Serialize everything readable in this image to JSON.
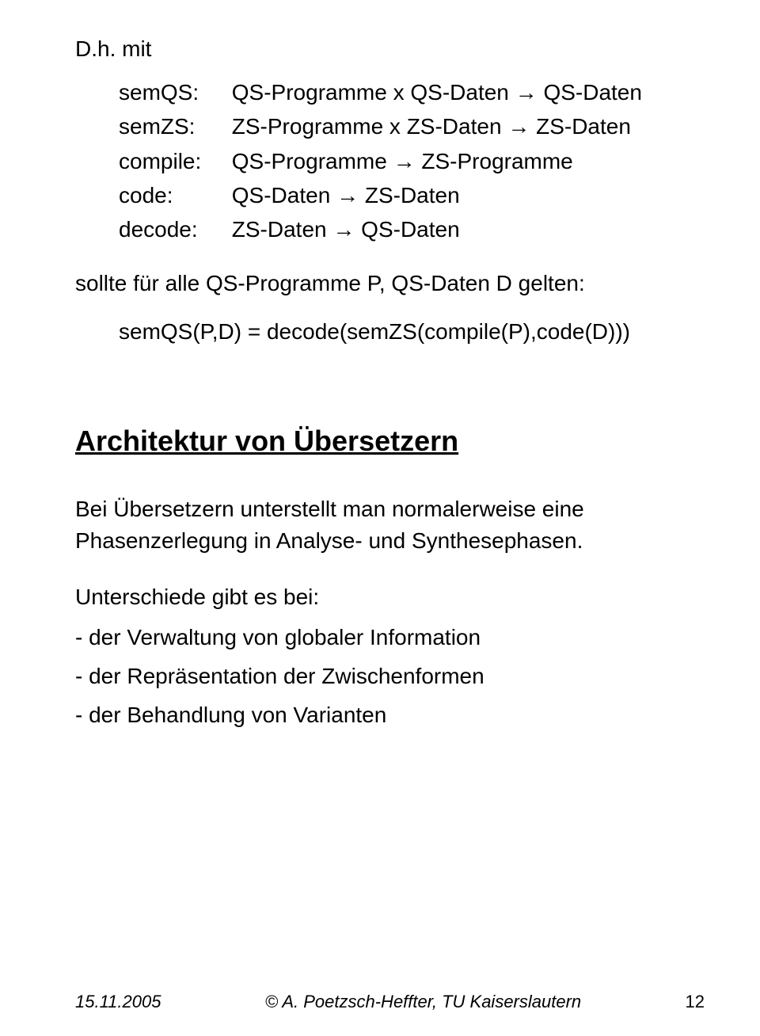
{
  "intro": "D.h. mit",
  "defs": {
    "semQS": {
      "label": "semQS:",
      "lhs": "QS-Programme x QS-Daten",
      "arrow": "→",
      "rhs": "QS-Daten"
    },
    "semZS": {
      "label": "semZS:",
      "lhs": "ZS-Programme x ZS-Daten",
      "arrow": "→",
      "rhs": "ZS-Daten"
    },
    "compile": {
      "label": "compile:",
      "lhs": "QS-Programme",
      "arrow": "→",
      "rhs": "ZS-Programme"
    },
    "code": {
      "label": "code:",
      "lhs": "QS-Daten",
      "arrow": "→",
      "rhs": "ZS-Daten"
    },
    "decode": {
      "label": "decode:",
      "lhs": "ZS-Daten",
      "arrow": "→",
      "rhs": "QS-Daten"
    }
  },
  "condition": "sollte für alle QS-Programme P, QS-Daten D gelten:",
  "equation": "semQS(P,D)  =  decode(semZS(compile(P),code(D)))",
  "section_title": "Architektur von Übersetzern",
  "para1": "Bei Übersetzern unterstellt man normalerweise eine Phasenzerlegung in Analyse- und Synthesephasen.",
  "para2": "Unterschiede gibt es bei:",
  "bullets": [
    "-  der Verwaltung von globaler Information",
    "-  der Repräsentation der Zwischenformen",
    "-  der Behandlung von Varianten"
  ],
  "footer": {
    "date": "15.11.2005",
    "center": "© A. Poetzsch-Heffter, TU Kaiserslautern",
    "page": "12"
  }
}
